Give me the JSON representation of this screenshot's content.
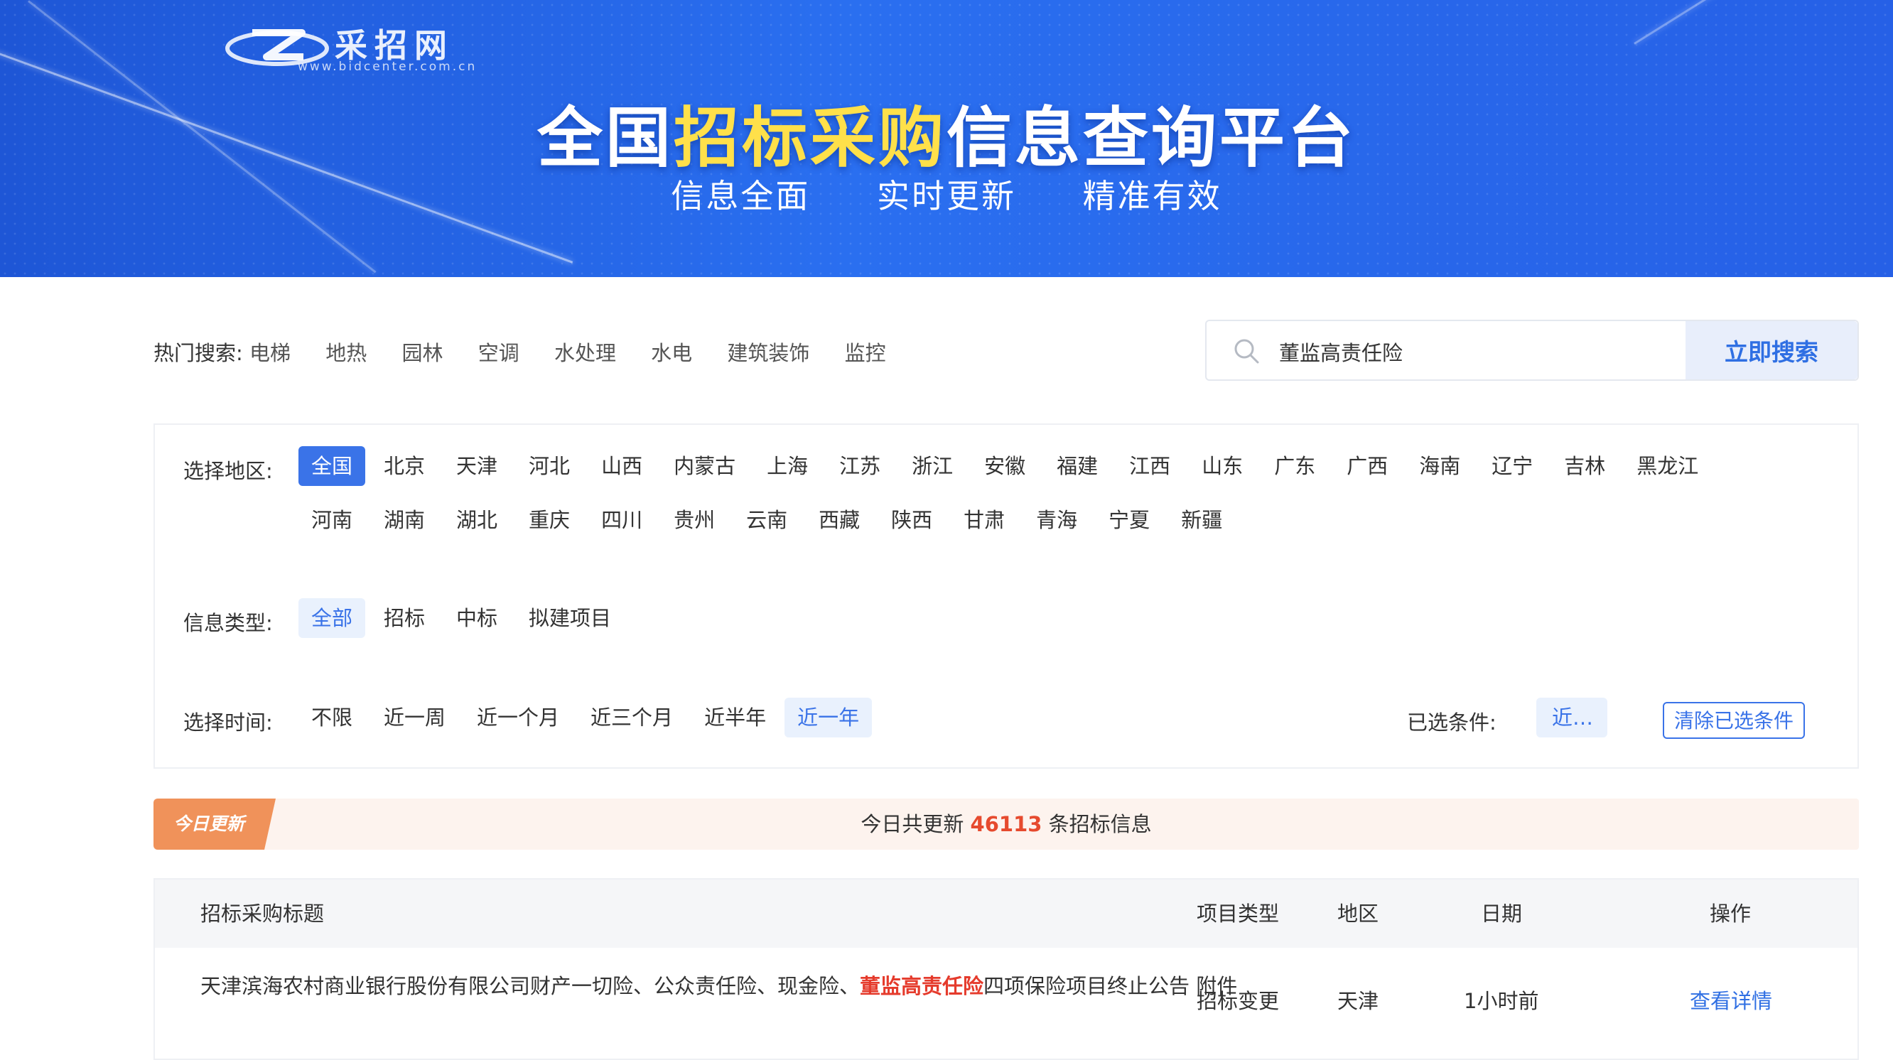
{
  "banner": {
    "logo_cn": "采招网",
    "logo_url": "www.bidcenter.com.cn",
    "title_pre": "全国",
    "title_highlight": "招标采购",
    "title_post": "信息查询平台",
    "slogans": [
      "信息全面",
      "实时更新",
      "精准有效"
    ]
  },
  "hot_search": {
    "label": "热门搜索:",
    "items": [
      "电梯",
      "地热",
      "园林",
      "空调",
      "水处理",
      "水电",
      "建筑装饰",
      "监控"
    ]
  },
  "search": {
    "value": "董监高责任险",
    "button_label": "立即搜索"
  },
  "filters": {
    "region": {
      "label": "选择地区:",
      "row1": [
        "全国",
        "北京",
        "天津",
        "河北",
        "山西",
        "内蒙古",
        "上海",
        "江苏",
        "浙江",
        "安徽",
        "福建",
        "江西",
        "山东",
        "广东",
        "广西",
        "海南",
        "辽宁",
        "吉林",
        "黑龙江"
      ],
      "row2": [
        "河南",
        "湖南",
        "湖北",
        "重庆",
        "四川",
        "贵州",
        "云南",
        "西藏",
        "陕西",
        "甘肃",
        "青海",
        "宁夏",
        "新疆"
      ],
      "selected": "全国"
    },
    "info_type": {
      "label": "信息类型:",
      "options": [
        "全部",
        "招标",
        "中标",
        "拟建项目"
      ],
      "selected": "全部"
    },
    "time": {
      "label": "选择时间:",
      "options": [
        "不限",
        "近一周",
        "近一个月",
        "近三个月",
        "近半年",
        "近一年"
      ],
      "selected": "近一年"
    },
    "selected_conditions": {
      "label": "已选条件:",
      "chip": "近...",
      "clear_label": "清除已选条件"
    }
  },
  "today": {
    "badge": "今日更新",
    "prefix": "今日共更新",
    "count": "46113",
    "suffix": "条招标信息"
  },
  "table": {
    "headers": {
      "title": "招标采购标题",
      "type": "项目类型",
      "region": "地区",
      "date": "日期",
      "action": "操作"
    },
    "rows": [
      {
        "title_pre": "天津滨海农村商业银行股份有限公司财产一切险、公众责任险、现金险、",
        "title_keyword": "董监高责任险",
        "title_post": "四项保险项目终止公告  附件",
        "type": "招标变更",
        "region": "天津",
        "date": "1小时前",
        "action": "查看详情"
      }
    ]
  },
  "colors": {
    "brand_blue": "#2f6fe3",
    "highlight_yellow": "#ffe04a",
    "keyword_red": "#e53b2c",
    "today_orange": "#f0925a"
  }
}
